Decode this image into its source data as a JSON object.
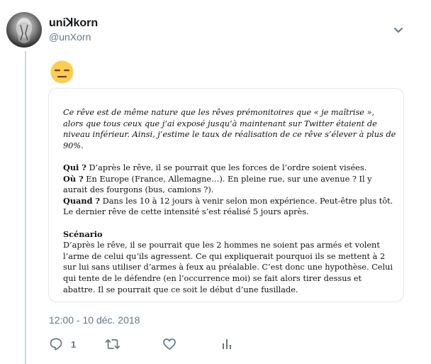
{
  "tweet": {
    "display_name": "uniꓘkorn",
    "handle": "@unXorn",
    "emoji_icon": "expressionless-face",
    "timestamp": "12:00 - 10 déc. 2018",
    "reply_count": "1"
  },
  "document": {
    "intro": "Ce rêve est de même nature que les rêves prémonitoires que « je maîtrise », alors que tous ceux que j’ai exposé jusqu’à maintenant sur Twitter étaient de niveau inférieur. Ainsi, j’estime le taux de réalisation de ce rêve s’élever à plus de 90%.",
    "qui_label": "Qui ?",
    "qui_text": " D’après le rêve, il se pourrait que les forces de l’ordre soient visées.",
    "ou_label": "Où ?",
    "ou_text": " En Europe (France, Allemagne…). En pleine rue, sur une avenue ? Il y aurait des fourgons (bus, camions ?).",
    "quand_label": "Quand ?",
    "quand_text": " Dans les 10 à 12 jours à venir selon mon expérience. Peut-être plus tôt.",
    "last_dream": "Le dernier rêve de cette intensité s’est réalisé 5 jours après.",
    "scenario_title": "Scénario",
    "scenario_text": "D’après le rêve, il se pourrait que les 2 hommes ne soient pas armés et volent l’arme de celui qu’ils agressent. Ce qui expliquerait pourquoi ils se mettent à 2 sur lui sans utiliser d’armes à feux au préalable. C’est donc une hypothèse. Celui qui tente de le défendre (en l’occurrence moi) se fait alors tirer dessus et abattre. Il se pourrait que ce soit le début d’une fusillade."
  },
  "icons": {
    "more": "chevron-down-icon",
    "reply": "reply-icon",
    "retweet": "retweet-icon",
    "like": "heart-icon",
    "analytics": "analytics-icon"
  },
  "colors": {
    "muted": "#657786",
    "border": "#e1e8ed",
    "emoji": "#ffcc4d"
  }
}
